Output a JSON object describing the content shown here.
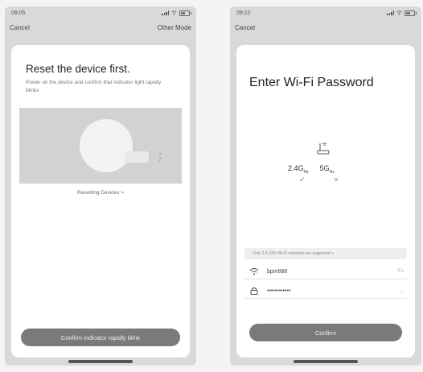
{
  "left": {
    "status": {
      "time": "09:05"
    },
    "nav": {
      "cancel": "Cancel",
      "other_mode": "Other Mode"
    },
    "title": "Reset the device first.",
    "description": "Power on the device and confirm that indicator light rapidly blinks",
    "illustration_text": "+ 2",
    "reset_link": "Resetting Devices >",
    "confirm_button": "Confirm indicator rapidly blink"
  },
  "right": {
    "status": {
      "time": "09:10"
    },
    "nav": {
      "cancel": "Cancel"
    },
    "title": "Enter Wi-Fi Password",
    "bands": [
      {
        "label": "2.4G",
        "unit": "Hz",
        "mark": "✓"
      },
      {
        "label": "5G",
        "unit": "Hz",
        "mark": "×"
      }
    ],
    "notice": "Only 2.4 GHz Wi-Fi networks are supported >",
    "ssid": {
      "value": "bpm888",
      "action": "Fo"
    },
    "password": {
      "value": "••••••••••••",
      "action": "⌄"
    },
    "confirm_button": "Confirm"
  }
}
